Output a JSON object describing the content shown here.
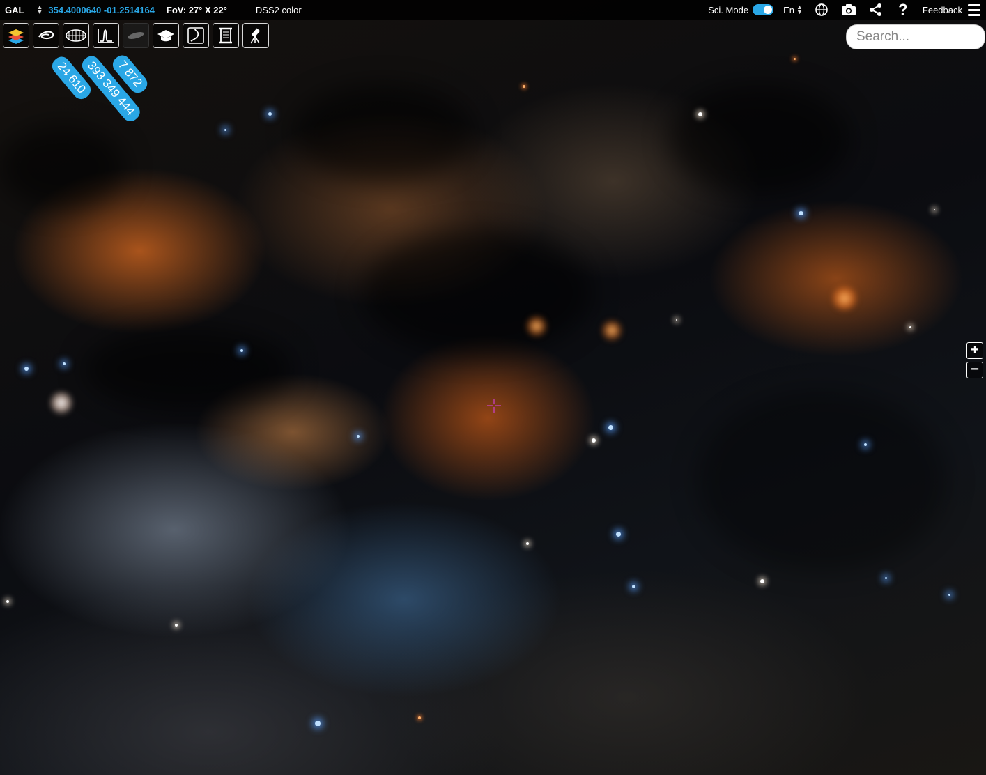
{
  "topbar": {
    "frame": "GAL",
    "coordinates": "354.4000640 -01.2514164",
    "fov": "FoV: 27° X 22°",
    "survey": "DSS2 color",
    "sci_mode_label": "Sci. Mode",
    "sci_mode_on": true,
    "language": "En",
    "feedback_label": "Feedback",
    "help_label": "?"
  },
  "toolbar": {
    "buttons": [
      {
        "name": "layers",
        "icon": "layers-icon",
        "active": false
      },
      {
        "name": "objects",
        "icon": "galaxy-spiral-icon",
        "active": false
      },
      {
        "name": "catalogs",
        "icon": "ellipse-grid-icon",
        "active": false
      },
      {
        "name": "spectra",
        "icon": "spectrum-peak-icon",
        "active": false
      },
      {
        "name": "missing-tool",
        "icon": "galaxy-disk-icon",
        "active": false,
        "disabled": true
      },
      {
        "name": "learn",
        "icon": "graduation-cap-icon",
        "active": false
      },
      {
        "name": "tour",
        "icon": "path-icon",
        "active": false
      },
      {
        "name": "history",
        "icon": "scroll-icon",
        "active": false
      },
      {
        "name": "observe",
        "icon": "telescope-icon",
        "active": false
      }
    ],
    "badges": [
      "24 610",
      "393 349 444",
      "7 872"
    ]
  },
  "search": {
    "placeholder": "Search..."
  },
  "zoom": {
    "in_label": "+",
    "out_label": "−"
  },
  "colors": {
    "accent": "#2aa7e6",
    "crosshair": "#d040d0",
    "topbar_bg": "#000000"
  }
}
